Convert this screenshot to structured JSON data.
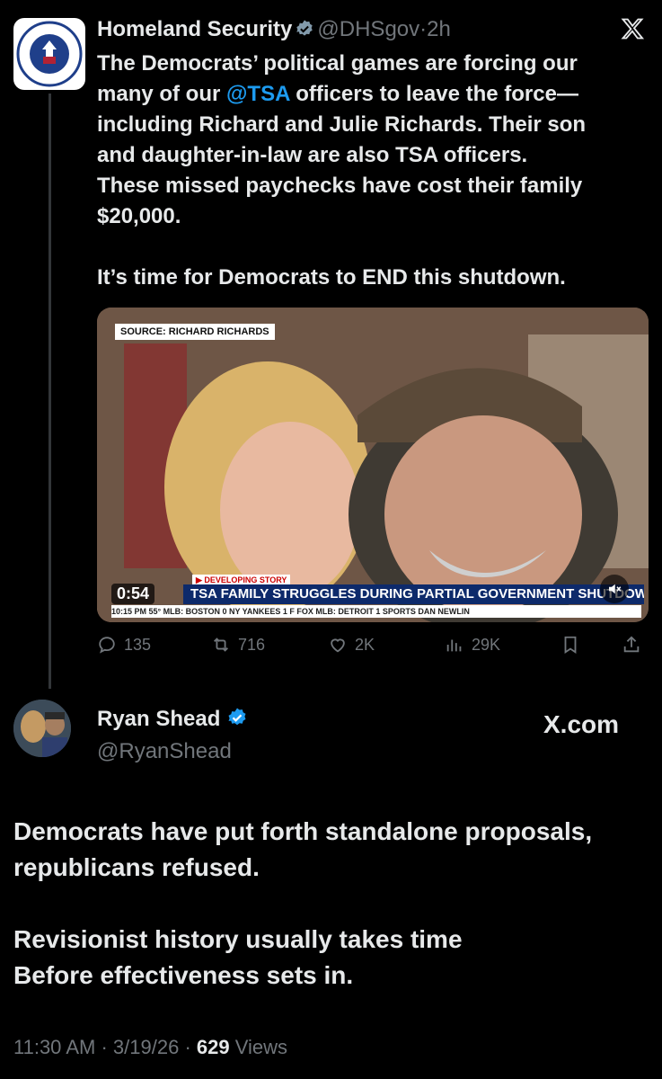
{
  "tweet1": {
    "name": "Homeland Security",
    "handle": "@DHSgov",
    "separator": "·",
    "time": "2h",
    "close_icon": "x-logo-icon",
    "lines": [
      "The Democrats’ political games are forcing our",
      "many of our @TSA officers to leave the force—",
      "including Richard and Julie Richards. Their son",
      "and daughter-in-law are also TSA officers.",
      "These missed paychecks have cost their family",
      "$20,000."
    ],
    "mention": "@TSA",
    "line2_before": "many of our ",
    "line2_after": " officers to leave the force—",
    "closing": "It’s time for Democrats to END this shutdown.",
    "media": {
      "source_tag": "SOURCE: RICHARD RICHARDS",
      "developing": "▶ DEVELOPING STORY",
      "headline": "TSA FAMILY STRUGGLES DURING PARTIAL GOVERNMENT SHUTDOWN",
      "ticker": "10:15 PM  55°   MLB:  BOSTON  0   NY YANKEES  1  F    FOX    MLB:  DETROIT  1    SPORTS        DAN NEWLIN",
      "duration": "0:54",
      "mute_icon": "mute-icon"
    },
    "actions": {
      "replies": "135",
      "reposts": "716",
      "likes": "2K",
      "views": "29K"
    }
  },
  "tweet2": {
    "name": "Ryan Shead",
    "handle": "@RyanShead",
    "brand": "X.com",
    "lines": [
      "Democrats have put forth standalone proposals,",
      "republicans refused.",
      "Revisionist history usually takes time",
      "Before effectiveness sets in."
    ],
    "time": "11:30 AM",
    "date": "3/19/26",
    "views_count": "629",
    "views_label": "Views",
    "separator": "·"
  },
  "colors": {
    "background": "#000000",
    "text": "#e7e9ea",
    "muted": "#71767b",
    "link": "#1d9bf0",
    "verified": "#1d9bf0"
  }
}
